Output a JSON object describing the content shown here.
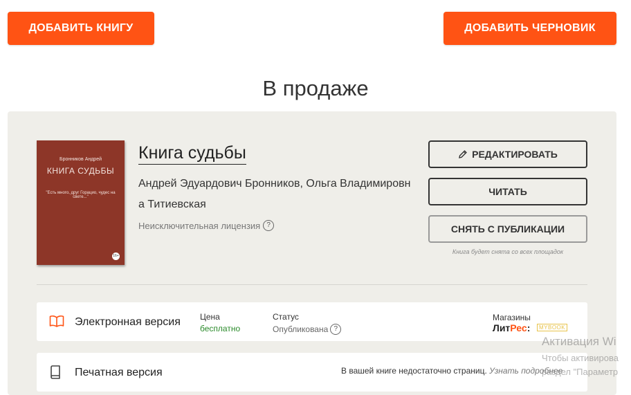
{
  "top_buttons": {
    "add_book": "ДОБАВИТЬ КНИГУ",
    "add_draft": "ДОБАВИТЬ ЧЕРНОВИК"
  },
  "section_title": "В продаже",
  "book": {
    "cover": {
      "author": "Бронников Андрей",
      "title": "КНИГА СУДЬБЫ",
      "quote": "\"Есть много, друг Горацио, чудес на свете...\"",
      "age": "16+"
    },
    "title": "Книга судьбы",
    "authors": "Андрей Эдуардович Бронников, Ольга Владимировна Титиевская",
    "license": "Неисключительная лицензия",
    "actions": {
      "edit": "РЕДАКТИРОВАТЬ",
      "read": "ЧИТАТЬ",
      "unpublish": "СНЯТЬ С ПУБЛИКАЦИИ",
      "unpublish_note": "Книга будет снята со всех площадок"
    }
  },
  "ebook": {
    "label": "Электронная версия",
    "price_label": "Цена",
    "price_value": "бесплатно",
    "status_label": "Статус",
    "status_value": "Опубликована",
    "stores_label": "Магазины",
    "store_litres_a": "Лит",
    "store_litres_b": "Рес",
    "store_litres_c": ":",
    "store_mybook": "MYBOOK"
  },
  "print": {
    "label": "Печатная версия",
    "note": "В вашей книге недостаточно страниц.",
    "note_link": "Узнать подробнее"
  },
  "os_watermark": {
    "line1": "Активация Wi",
    "line2": "Чтобы активирова",
    "line3": "раздел \"Параметр"
  },
  "colors": {
    "accent": "#ff5314",
    "panel_bg": "#efeee9",
    "price_green": "#2a8a2a"
  }
}
